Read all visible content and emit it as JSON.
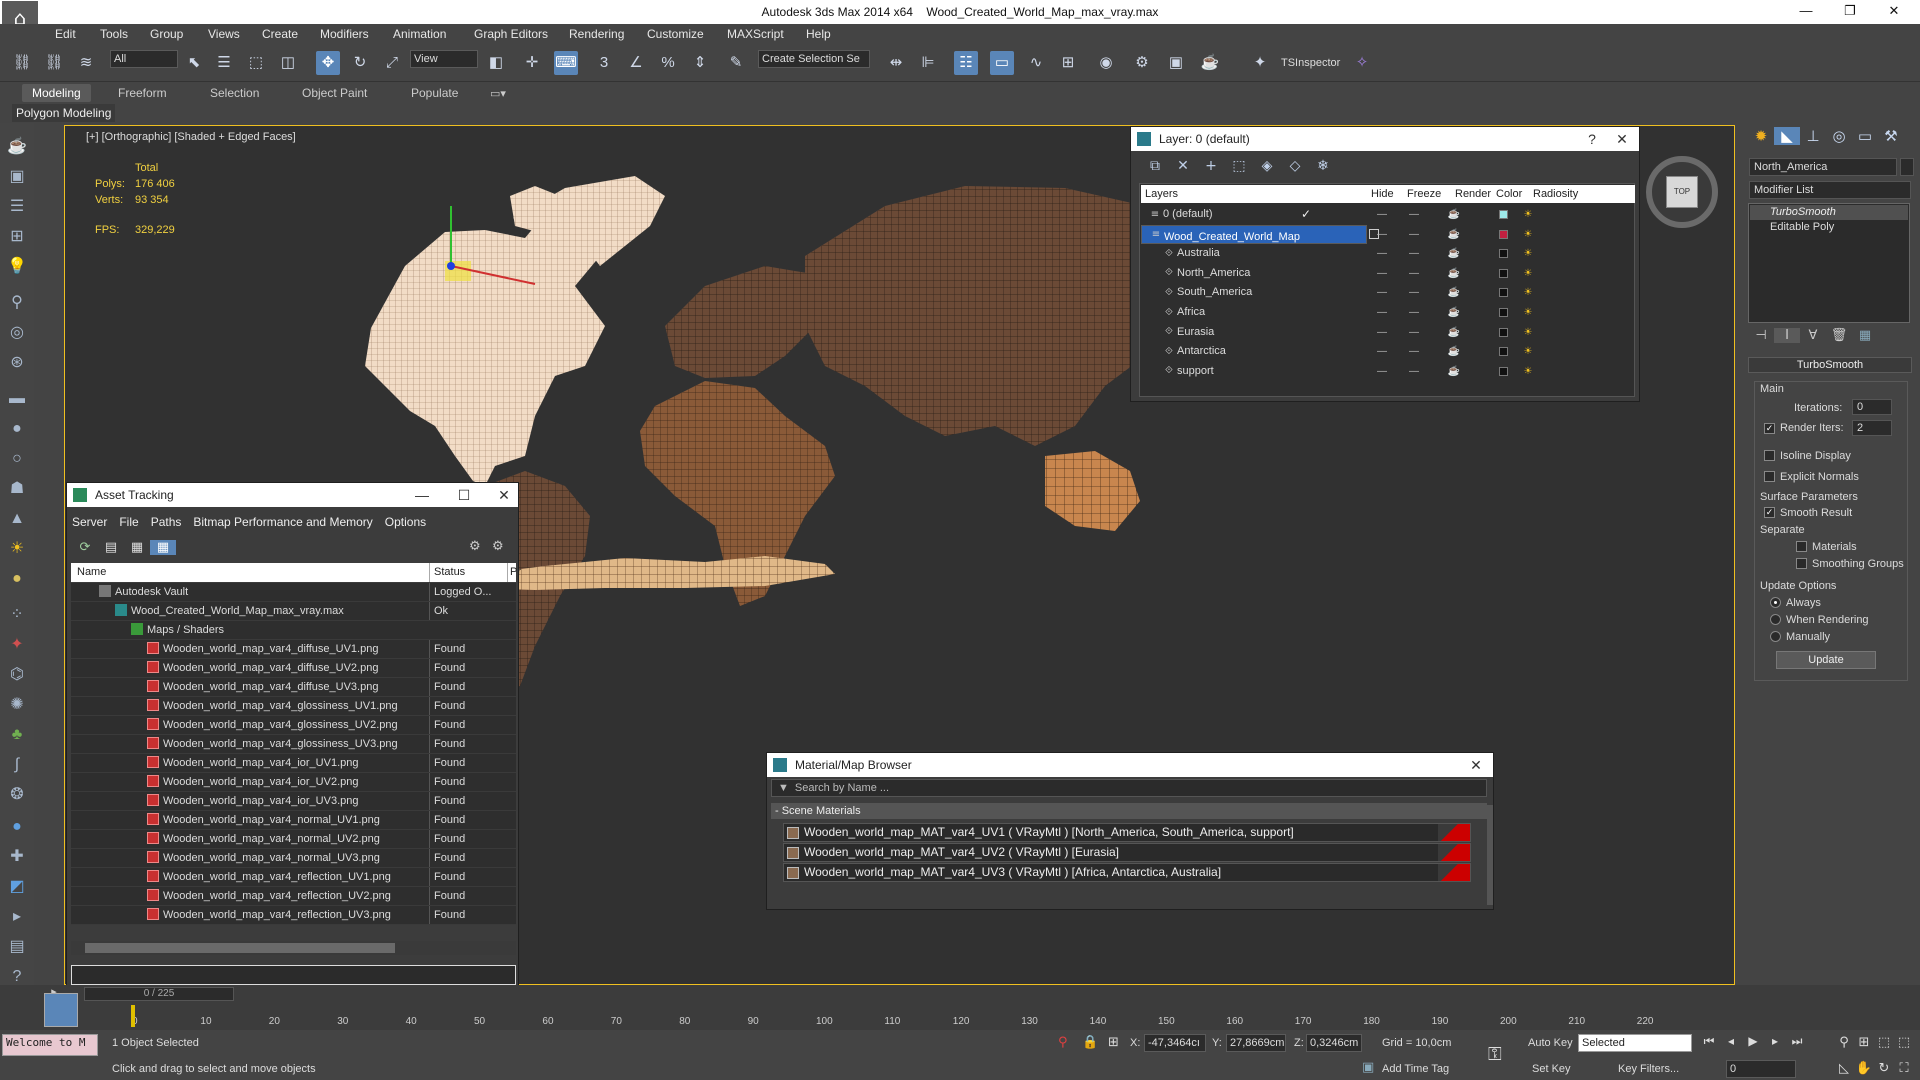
{
  "title_bar": {
    "app": "Autodesk 3ds Max  2014 x64",
    "file": "Wood_Created_World_Map_max_vray.max"
  },
  "menu": [
    "Edit",
    "Tools",
    "Group",
    "Views",
    "Create",
    "Modifiers",
    "Animation",
    "Graph Editors",
    "Rendering",
    "Customize",
    "MAXScript",
    "Help"
  ],
  "toolbar": {
    "selection_filter": "All",
    "ref_coord": "View",
    "named_selection": "Create Selection Se",
    "tsinspector": "TSInspector"
  },
  "ribbon": {
    "tabs": [
      "Modeling",
      "Freeform",
      "Selection",
      "Object Paint",
      "Populate"
    ],
    "subtitle": "Polygon Modeling"
  },
  "viewport": {
    "label": "[+] [Orthographic] [Shaded + Edged Faces]",
    "stats": {
      "total_label": "Total",
      "polys_label": "Polys:",
      "polys": "176 406",
      "verts_label": "Verts:",
      "verts": "93 354",
      "fps_label": "FPS:",
      "fps": "329,229"
    },
    "viewcube_label": "TOP"
  },
  "layer_window": {
    "title": "Layer: 0 (default)",
    "columns": [
      "Layers",
      "Hide",
      "Freeze",
      "Render",
      "Color",
      "Radiosity"
    ],
    "rows": [
      {
        "name": "0 (default)",
        "color": "#9de8e8"
      },
      {
        "name": "Wood_Created_World_Map",
        "color": "#c02040"
      },
      {
        "name": "Australia",
        "color": "#111111"
      },
      {
        "name": "North_America",
        "color": "#111111"
      },
      {
        "name": "South_America",
        "color": "#111111"
      },
      {
        "name": "Africa",
        "color": "#111111"
      },
      {
        "name": "Eurasia",
        "color": "#111111"
      },
      {
        "name": "Antarctica",
        "color": "#111111"
      },
      {
        "name": "support",
        "color": "#111111"
      }
    ]
  },
  "asset_window": {
    "title": "Asset Tracking",
    "menu": [
      "Server",
      "File",
      "Paths",
      "Bitmap Performance and Memory",
      "Options"
    ],
    "columns": [
      "Name",
      "Status",
      "Pr"
    ],
    "rows": [
      {
        "name": "Autodesk Vault",
        "status": "Logged O..."
      },
      {
        "name": "Wood_Created_World_Map_max_vray.max",
        "status": "Ok"
      },
      {
        "name": "Maps / Shaders",
        "status": ""
      },
      {
        "name": "Wooden_world_map_var4_diffuse_UV1.png",
        "status": "Found"
      },
      {
        "name": "Wooden_world_map_var4_diffuse_UV2.png",
        "status": "Found"
      },
      {
        "name": "Wooden_world_map_var4_diffuse_UV3.png",
        "status": "Found"
      },
      {
        "name": "Wooden_world_map_var4_glossiness_UV1.png",
        "status": "Found"
      },
      {
        "name": "Wooden_world_map_var4_glossiness_UV2.png",
        "status": "Found"
      },
      {
        "name": "Wooden_world_map_var4_glossiness_UV3.png",
        "status": "Found"
      },
      {
        "name": "Wooden_world_map_var4_ior_UV1.png",
        "status": "Found"
      },
      {
        "name": "Wooden_world_map_var4_ior_UV2.png",
        "status": "Found"
      },
      {
        "name": "Wooden_world_map_var4_ior_UV3.png",
        "status": "Found"
      },
      {
        "name": "Wooden_world_map_var4_normal_UV1.png",
        "status": "Found"
      },
      {
        "name": "Wooden_world_map_var4_normal_UV2.png",
        "status": "Found"
      },
      {
        "name": "Wooden_world_map_var4_normal_UV3.png",
        "status": "Found"
      },
      {
        "name": "Wooden_world_map_var4_reflection_UV1.png",
        "status": "Found"
      },
      {
        "name": "Wooden_world_map_var4_reflection_UV2.png",
        "status": "Found"
      },
      {
        "name": "Wooden_world_map_var4_reflection_UV3.png",
        "status": "Found"
      }
    ]
  },
  "material_browser": {
    "title": "Material/Map Browser",
    "search_placeholder": "Search by Name ...",
    "group": "- Scene Materials",
    "materials": [
      "Wooden_world_map_MAT_var4_UV1  ( VRayMtl ) [North_America, South_America, support]",
      "Wooden_world_map_MAT_var4_UV2  ( VRayMtl ) [Eurasia]",
      "Wooden_world_map_MAT_var4_UV3  ( VRayMtl ) [Africa, Antarctica, Australia]"
    ]
  },
  "command_panel": {
    "object_name": "North_America",
    "modifier_list": "Modifier List",
    "stack": [
      "TurboSmooth",
      "Editable Poly"
    ],
    "rollout_title": "TurboSmooth",
    "main_label": "Main",
    "iterations_label": "Iterations:",
    "iterations": "0",
    "render_iters_label": "Render Iters:",
    "render_iters": "2",
    "isoline": "Isoline Display",
    "explicit": "Explicit Normals",
    "surface_label": "Surface Parameters",
    "smooth_result": "Smooth Result",
    "separate_label": "Separate",
    "materials": "Materials",
    "smoothing_groups": "Smoothing Groups",
    "update_label": "Update Options",
    "always": "Always",
    "when_rendering": "When Rendering",
    "manually": "Manually",
    "update_button": "Update"
  },
  "timeline": {
    "frame": "0 / 225",
    "ticks": [
      "0",
      "10",
      "20",
      "30",
      "40",
      "50",
      "60",
      "70",
      "80",
      "90",
      "100",
      "110",
      "120",
      "130",
      "140",
      "150",
      "160",
      "170",
      "180",
      "190",
      "200",
      "210",
      "220"
    ]
  },
  "status": {
    "welcome": "Welcome to M",
    "selected": "1 Object Selected",
    "hint": "Click and drag to select and move objects",
    "x_label": "X:",
    "x": "-47,3464cı",
    "y_label": "Y:",
    "y": "27,8669cm",
    "z_label": "Z:",
    "z": "0,3246cm",
    "grid": "Grid = 10,0cm",
    "add_time_tag": "Add Time Tag",
    "auto_key": "Auto Key",
    "set_key": "Set Key",
    "key_mode": "Selected",
    "key_filters": "Key Filters...",
    "frame_field": "0"
  }
}
